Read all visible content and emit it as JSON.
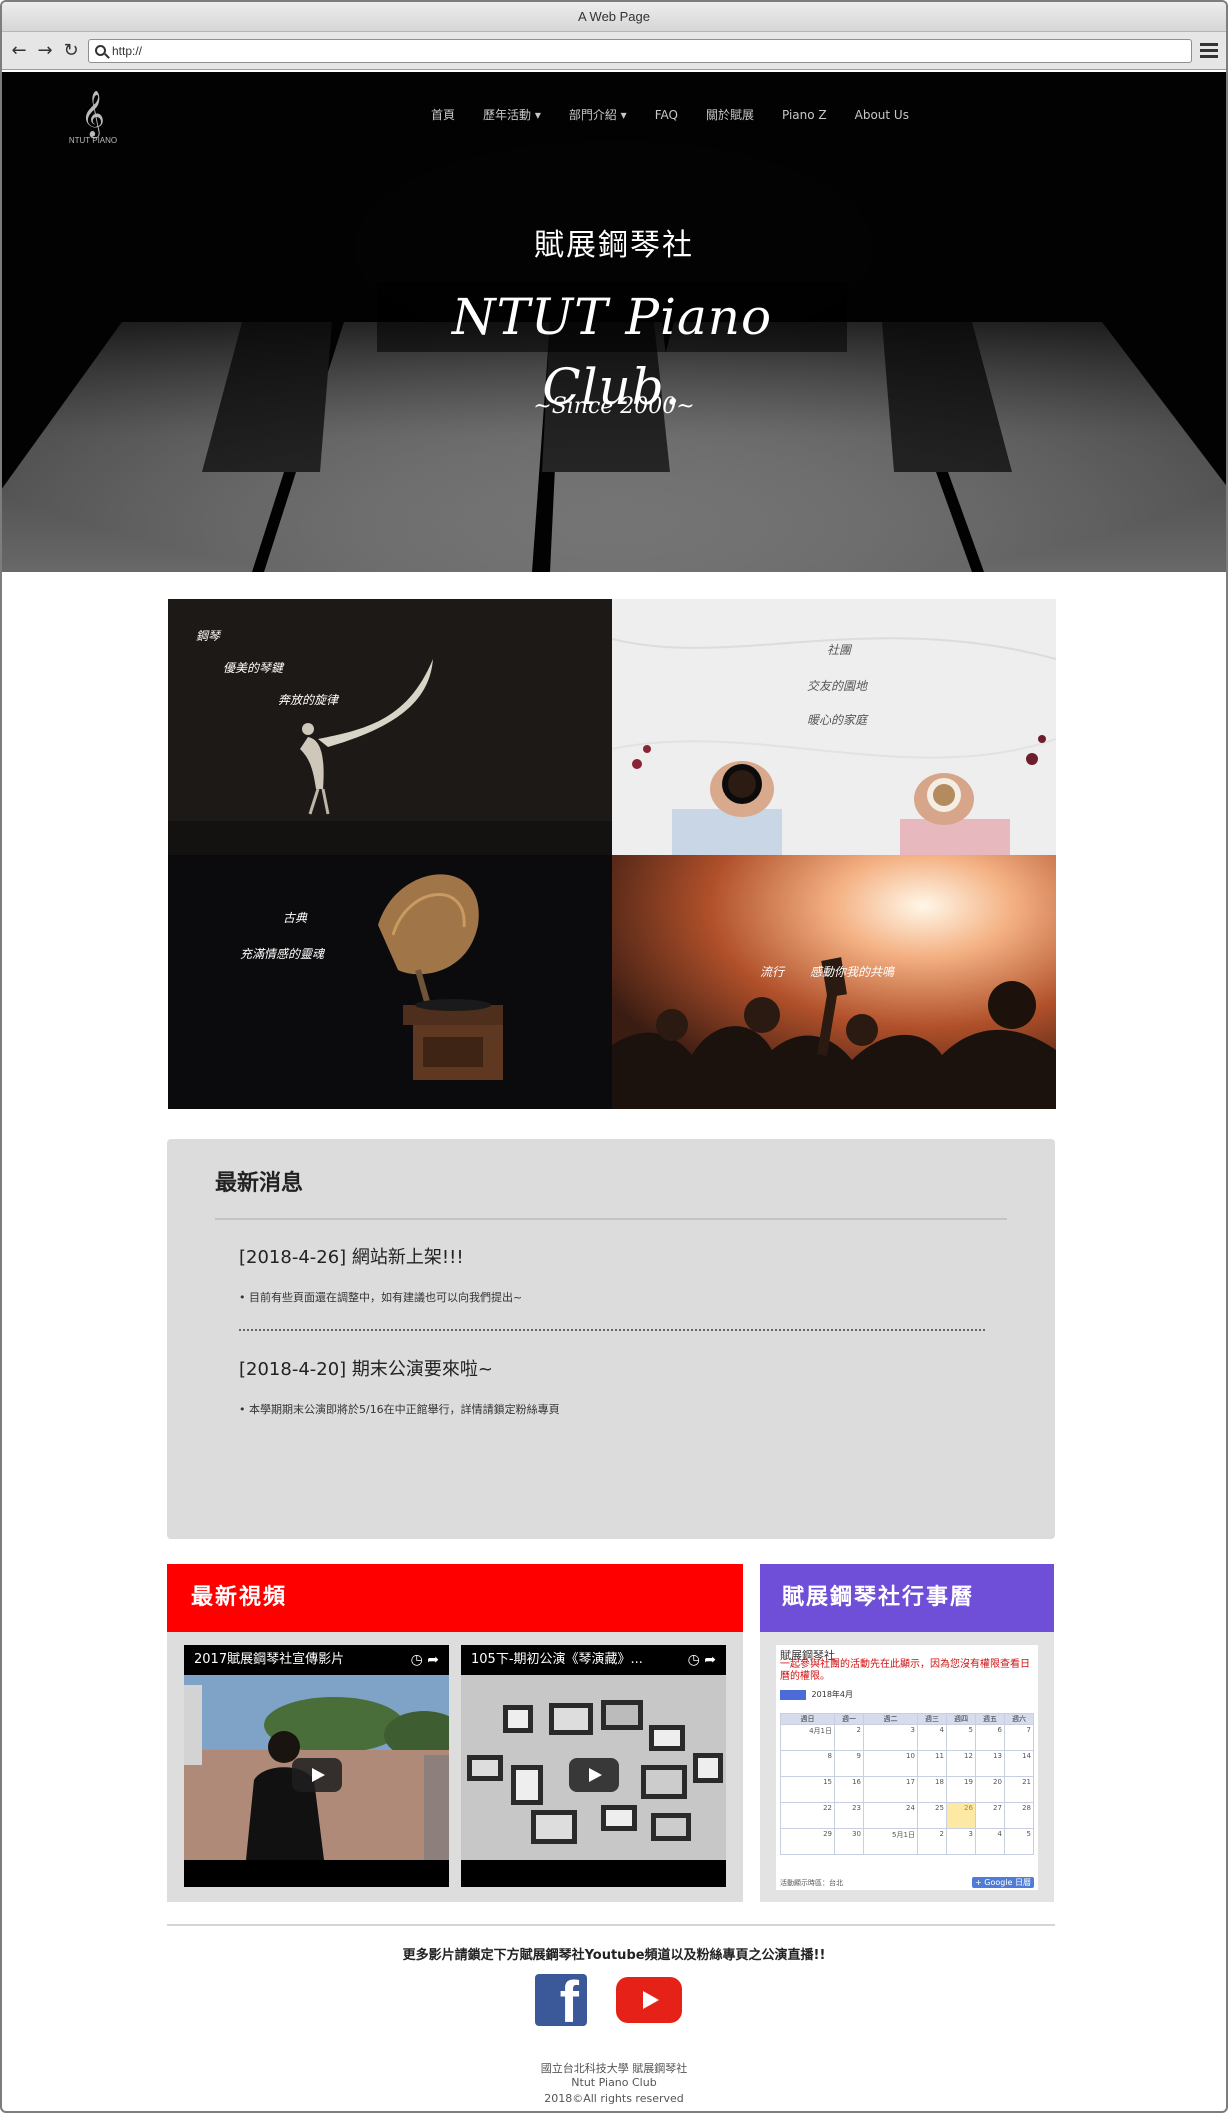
{
  "browser": {
    "window_title": "A Web Page",
    "address": "http://"
  },
  "nav": {
    "logo_text": "NTUT PIANO",
    "items": [
      "首頁",
      "歷年活動 ▾",
      "部門介紹 ▾",
      "FAQ",
      "關於賦展",
      "Piano Z",
      "About Us"
    ]
  },
  "hero": {
    "subtitle": "賦展鋼琴社",
    "title": "NTUT Piano Club.",
    "since": "~Since 2000~"
  },
  "gallery": {
    "tiles": [
      {
        "lines": [
          "鋼琴",
          "優美的琴鍵",
          "奔放的旋律"
        ]
      },
      {
        "lines": [
          "社團",
          "交友的園地",
          "暖心的家庭"
        ]
      },
      {
        "lines": [
          "古典",
          "充滿情感的靈魂"
        ]
      },
      {
        "lines": [
          "流行",
          "感動你我的共鳴"
        ]
      }
    ]
  },
  "news": {
    "heading": "最新消息",
    "items": [
      {
        "title": "[2018-4-26] 網站新上架!!!",
        "body": "• 目前有些頁面還在調整中，如有建議也可以向我們提出~"
      },
      {
        "title": "[2018-4-20] 期末公演要來啦~",
        "body": "• 本學期期末公演即將於5/16在中正館舉行，詳情請鎖定粉絲專頁"
      }
    ]
  },
  "videos": {
    "heading": "最新視頻",
    "items": [
      {
        "title": "2017賦展鋼琴社宣傳影片"
      },
      {
        "title": "105下-期初公演《琴演藏》..."
      }
    ]
  },
  "calendar": {
    "heading": "賦展鋼琴社行事曆",
    "name": "賦展鋼琴社",
    "notice": "一起參與社團的活動先在此顯示，因為您沒有權限查看日曆的權限。",
    "month_label": "2018年4月",
    "weekdays": [
      "週日",
      "週一",
      "週二",
      "週三",
      "週四",
      "週五",
      "週六"
    ],
    "weeks": [
      [
        "4月1日",
        "2",
        "3",
        "4",
        "5",
        "6",
        "7"
      ],
      [
        "8",
        "9",
        "10",
        "11",
        "12",
        "13",
        "14"
      ],
      [
        "15",
        "16",
        "17",
        "18",
        "19",
        "20",
        "21"
      ],
      [
        "22",
        "23",
        "24",
        "25",
        "26",
        "27",
        "28"
      ],
      [
        "29",
        "30",
        "5月1日",
        "2",
        "3",
        "4",
        "5"
      ]
    ],
    "today": "26",
    "footer": "活動顯示時區：台北",
    "badge": "+ Google 日曆"
  },
  "footer": {
    "more_text": "更多影片請鎖定下方賦展鋼琴社Youtube頻道以及粉絲專頁之公演直播!!",
    "fb_glyph": "f",
    "lines": [
      "國立台北科技大學 賦展鋼琴社",
      "Ntut Piano Club",
      "2018©All rights reserved"
    ]
  },
  "colors": {
    "video_header": "#ff0000",
    "calendar_header": "#6f4fd8",
    "news_bg": "#dcdcdc",
    "facebook": "#3b5998",
    "youtube": "#e62117"
  }
}
